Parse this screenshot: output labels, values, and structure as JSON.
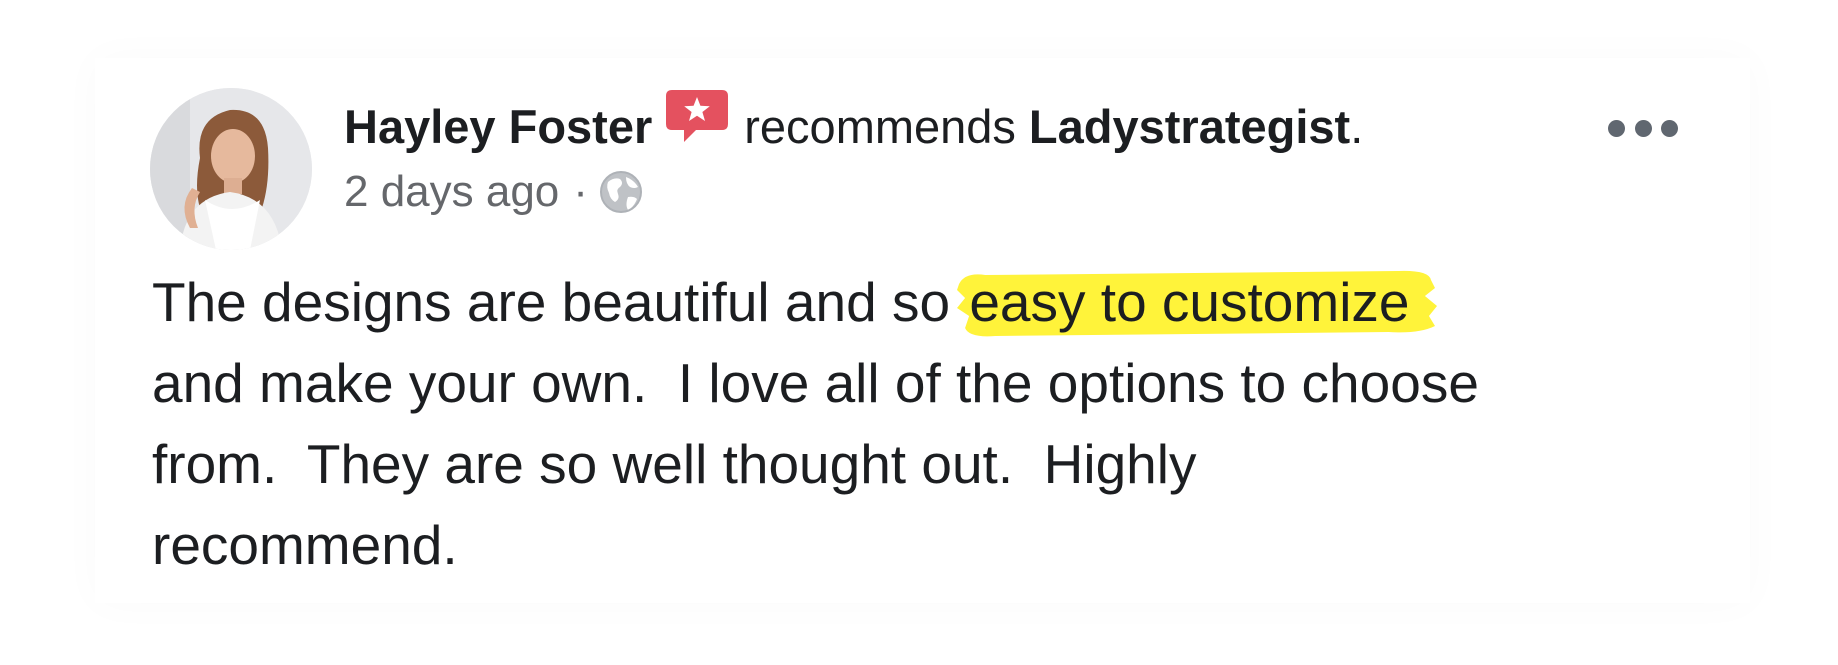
{
  "post": {
    "author_name": "Hayley Foster",
    "action_text": "recommends",
    "page_name": "Ladystrategist",
    "page_name_suffix": ".",
    "timestamp": "2 days ago",
    "separator": "·",
    "privacy_icon": "globe-icon",
    "recommend_icon": "recommend-star-icon",
    "more_icon": "more-options-icon",
    "body": {
      "before_highlight": "The designs are beautiful and so ",
      "highlight": "easy to customize",
      "line_2": "and make your own.  I love all of the options to choose",
      "line_3": "from.  They are so well thought out.  Highly",
      "line_4": "recommend."
    }
  },
  "colors": {
    "recommend_red": "#e4515f",
    "highlight_yellow": "#fff33a",
    "meta_gray": "#65676b",
    "text": "#1c1e21"
  }
}
